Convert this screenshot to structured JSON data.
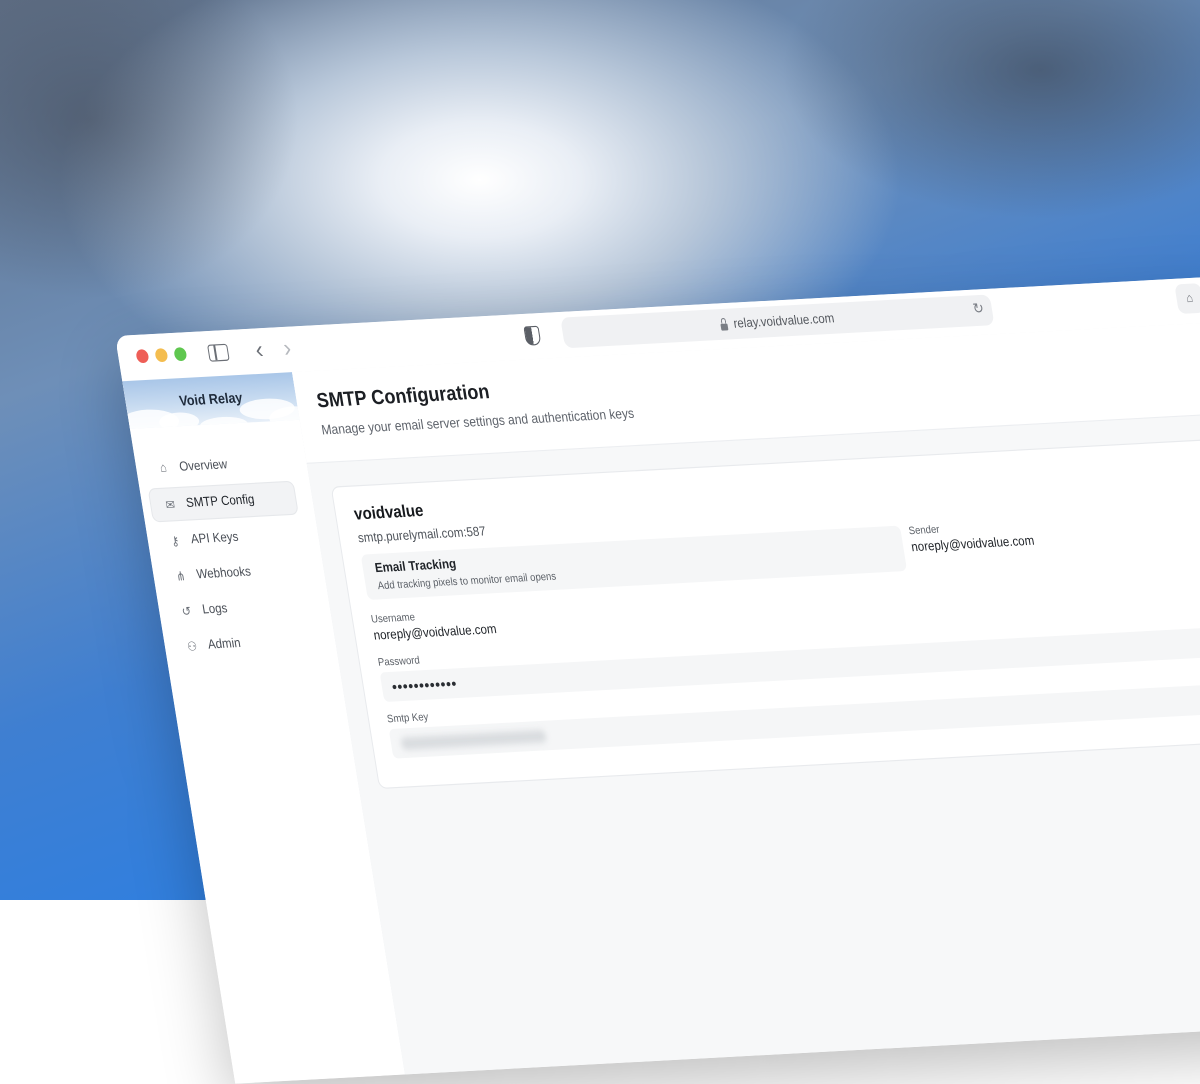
{
  "browser": {
    "url": "relay.voidvalue.com"
  },
  "sidebar": {
    "brand": "Void Relay",
    "items": [
      {
        "label": "Overview",
        "icon": "home-icon",
        "active": false
      },
      {
        "label": "SMTP Config",
        "icon": "inbox-icon",
        "active": true
      },
      {
        "label": "API Keys",
        "icon": "key-icon",
        "active": false
      },
      {
        "label": "Webhooks",
        "icon": "webhook-icon",
        "active": false
      },
      {
        "label": "Logs",
        "icon": "history-icon",
        "active": false
      },
      {
        "label": "Admin",
        "icon": "user-admin-icon",
        "active": false
      }
    ]
  },
  "header": {
    "title": "SMTP Configuration",
    "subtitle": "Manage your email server settings and authentication keys"
  },
  "config_card": {
    "name": "voidvalue",
    "host": "smtp.purelymail.com:587",
    "tracking": {
      "title": "Email Tracking",
      "description": "Add tracking pixels to monitor email opens"
    },
    "sender": {
      "label": "Sender",
      "value": "noreply@voidvalue.com"
    },
    "username": {
      "label": "Username",
      "value": "noreply@voidvalue.com"
    },
    "password": {
      "label": "Password",
      "value": "••••••••••••"
    },
    "smtp_key": {
      "label": "Smtp Key"
    }
  },
  "colors": {
    "close": "#ee5e57",
    "minimize": "#f4bd4f",
    "zoom": "#5fc74f",
    "active_nav_bg": "#f2f3f5"
  }
}
